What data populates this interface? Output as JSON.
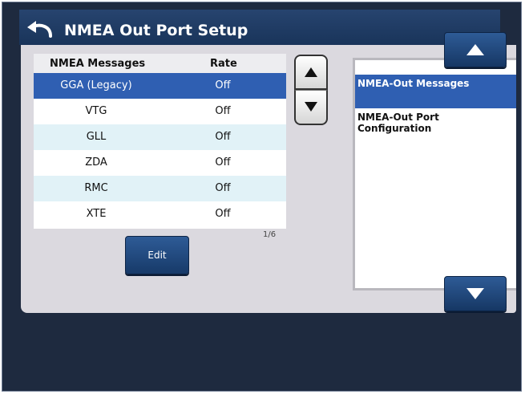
{
  "header": {
    "title": "NMEA Out Port Setup",
    "back_icon": "back-arrow-icon"
  },
  "table": {
    "columns": [
      "NMEA Messages",
      "Rate"
    ],
    "rows": [
      {
        "message": "GGA (Legacy)",
        "rate": "Off",
        "selected": true
      },
      {
        "message": "VTG",
        "rate": "Off"
      },
      {
        "message": "GLL",
        "rate": "Off"
      },
      {
        "message": "ZDA",
        "rate": "Off"
      },
      {
        "message": "RMC",
        "rate": "Off"
      },
      {
        "message": "XTE",
        "rate": "Off"
      }
    ],
    "page_indicator": "1/6"
  },
  "edit_button": {
    "label": "Edit"
  },
  "side_list": {
    "items": [
      {
        "label": "NMEA-Out Messages",
        "active": true
      },
      {
        "label": "NMEA-Out Port Configuration"
      }
    ]
  },
  "colors": {
    "accent": "#2f5fb2",
    "header": "#1e3a64",
    "frame": "#1e2a3f",
    "panel": "#dbd9df",
    "row_alt": "#e1f2f7"
  }
}
